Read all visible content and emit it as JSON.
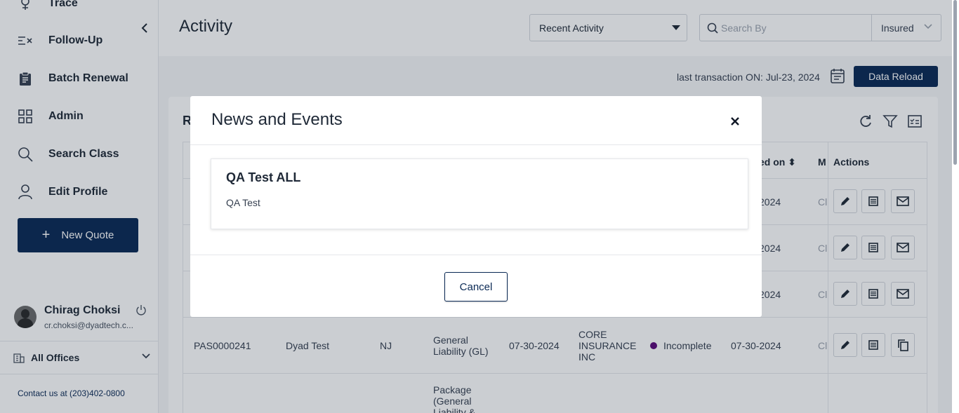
{
  "sidebar": {
    "items": [
      {
        "label": "Trace",
        "icon": "trace-icon"
      },
      {
        "label": "Follow-Up",
        "icon": "follow-up-icon"
      },
      {
        "label": "Batch Renewal",
        "icon": "clipboard-icon"
      },
      {
        "label": "Admin",
        "icon": "grid-icon"
      },
      {
        "label": "Search Class",
        "icon": "search-icon"
      },
      {
        "label": "Edit Profile",
        "icon": "user-icon"
      }
    ],
    "new_quote_label": "New Quote",
    "user": {
      "name": "Chirag Choksi",
      "email": "cr.choksi@dyadtech.c..."
    },
    "office_label": "All Offices",
    "contact": "Contact us at (203)402-0800"
  },
  "header": {
    "title": "Activity",
    "activity_select": "Recent Activity",
    "search_placeholder": "Search By",
    "search_scope": "Insured"
  },
  "toolbar": {
    "last_transaction": "last transaction ON: Jul-23, 2024",
    "data_reload_label": "Data Reload"
  },
  "card": {
    "title_fragment": "R",
    "header_fragments": {
      "col_date": "ed on",
      "col_m": "M",
      "actions": "Actions"
    }
  },
  "rows": [
    {
      "date_fragment": "2024",
      "m_fragment": "Cl"
    },
    {
      "date_fragment": "2024",
      "m_fragment": "Cl"
    },
    {
      "date_fragment": "2024",
      "m_fragment": "Cl"
    },
    {
      "number": "PAS0000241",
      "insured": "Dyad Test",
      "state": "NJ",
      "product": "General Liability (GL)",
      "effective": "07-30-2024",
      "carrier": "CORE INSURANCE INC",
      "status": "Incomplete",
      "updated": "07-30-2024",
      "m_fragment": "Cl"
    },
    {
      "product": "Package (General Liability &"
    }
  ],
  "modal": {
    "title": "News and Events",
    "item_title": "QA Test ALL",
    "item_body": "QA Test",
    "cancel_label": "Cancel"
  },
  "colors": {
    "primary": "#0b2a55",
    "status_incomplete": "#5b0a7a"
  }
}
